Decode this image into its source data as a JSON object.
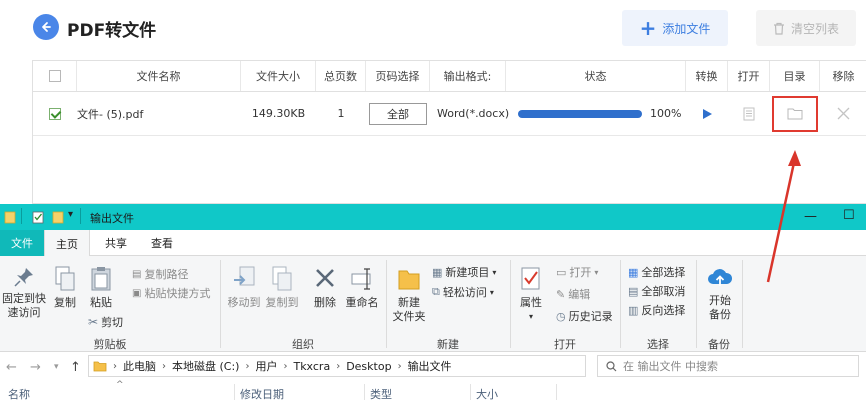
{
  "app": {
    "title": "PDF转文件",
    "add_button": "添加文件",
    "clear_button": "清空列表",
    "accent_color": "#4a86e8",
    "columns": [
      "文件名称",
      "文件大小",
      "总页数",
      "页码选择",
      "输出格式:",
      "状态",
      "转换",
      "打开",
      "目录",
      "移除"
    ],
    "rows": [
      {
        "checked": true,
        "name": "文件- (5).pdf",
        "size": "149.30KB",
        "pages": "1",
        "range": "全部",
        "format": "Word(*.docx)",
        "progress": 100,
        "progress_text": "100%"
      }
    ]
  },
  "explorer": {
    "title": "输出文件",
    "title_bar_color": "#10c8c8",
    "tabs": [
      "文件",
      "主页",
      "共享",
      "查看"
    ],
    "ribbon": {
      "clipboard": {
        "label": "剪贴板",
        "pin": "固定到快速访问",
        "copy": "复制",
        "paste": "粘贴",
        "copy_path": "复制路径",
        "paste_shortcut": "粘贴快捷方式",
        "cut": "剪切"
      },
      "organize": {
        "label": "组织",
        "move_to": "移动到",
        "copy_to": "复制到",
        "delete": "删除",
        "rename": "重命名"
      },
      "new": {
        "label": "新建",
        "new_folder": "新建\n文件夹",
        "new_item": "新建项目",
        "easy_access": "轻松访问"
      },
      "open": {
        "label": "打开",
        "properties": "属性",
        "open": "打开",
        "edit": "编辑",
        "history": "历史记录"
      },
      "select": {
        "label": "选择",
        "select_all": "全部选择",
        "select_none": "全部取消",
        "invert": "反向选择"
      },
      "backup": {
        "label": "备份",
        "start_backup": "开始\n备份"
      }
    },
    "path": [
      "此电脑",
      "本地磁盘 (C:)",
      "用户",
      "Tkxcra",
      "Desktop",
      "输出文件"
    ],
    "search_placeholder": "在 输出文件 中搜索",
    "columns": [
      "名称",
      "修改日期",
      "类型",
      "大小"
    ]
  }
}
